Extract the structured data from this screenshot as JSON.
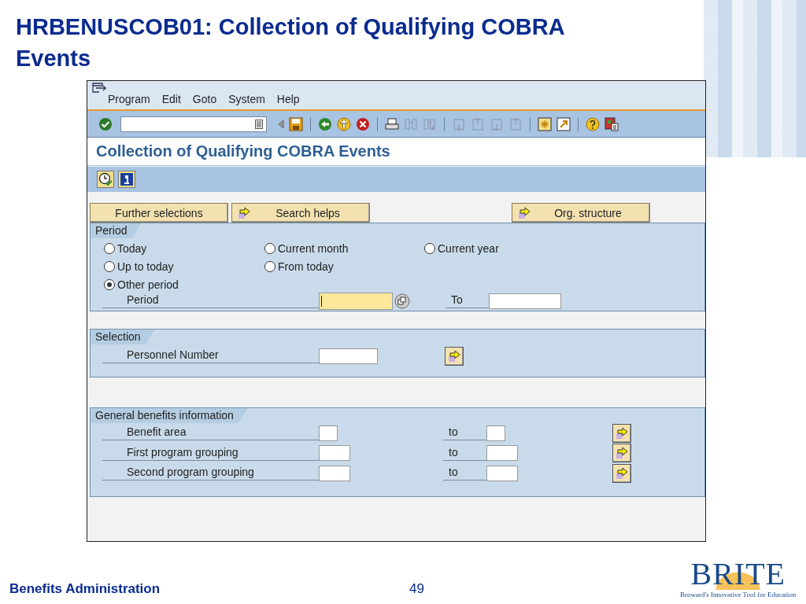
{
  "slide": {
    "title": "HRBENUSCOB01: Collection of Qualifying COBRA Events",
    "footer": "Benefits Administration",
    "page_number": "49",
    "logo": {
      "name": "BRITE",
      "tagline": "Broward's Innovative Tool for Education"
    }
  },
  "window": {
    "menu": [
      "Program",
      "Edit",
      "Goto",
      "System",
      "Help"
    ],
    "title": "Collection of Qualifying COBRA Events"
  },
  "selection_buttons": [
    {
      "label": "Further selections",
      "kind": "plain"
    },
    {
      "label": "Search helps",
      "kind": "arrow"
    },
    {
      "label": "Org. structure",
      "kind": "arrow"
    }
  ],
  "period": {
    "title": "Period",
    "options": [
      {
        "label": "Today",
        "selected": false
      },
      {
        "label": "Current month",
        "selected": false
      },
      {
        "label": "Current year",
        "selected": false
      },
      {
        "label": "Up to today",
        "selected": false
      },
      {
        "label": "From today",
        "selected": false
      },
      {
        "label": "Other period",
        "selected": true
      }
    ],
    "field_label": "Period",
    "to_label": "To"
  },
  "selection": {
    "title": "Selection",
    "fields": [
      {
        "label": "Personnel Number"
      }
    ]
  },
  "general": {
    "title": "General benefits information",
    "rows": [
      {
        "label": "Benefit area",
        "to_label": "to",
        "kind": "short"
      },
      {
        "label": "First program grouping",
        "to_label": "to",
        "kind": "long"
      },
      {
        "label": "Second program grouping",
        "to_label": "to",
        "kind": "long"
      }
    ]
  }
}
